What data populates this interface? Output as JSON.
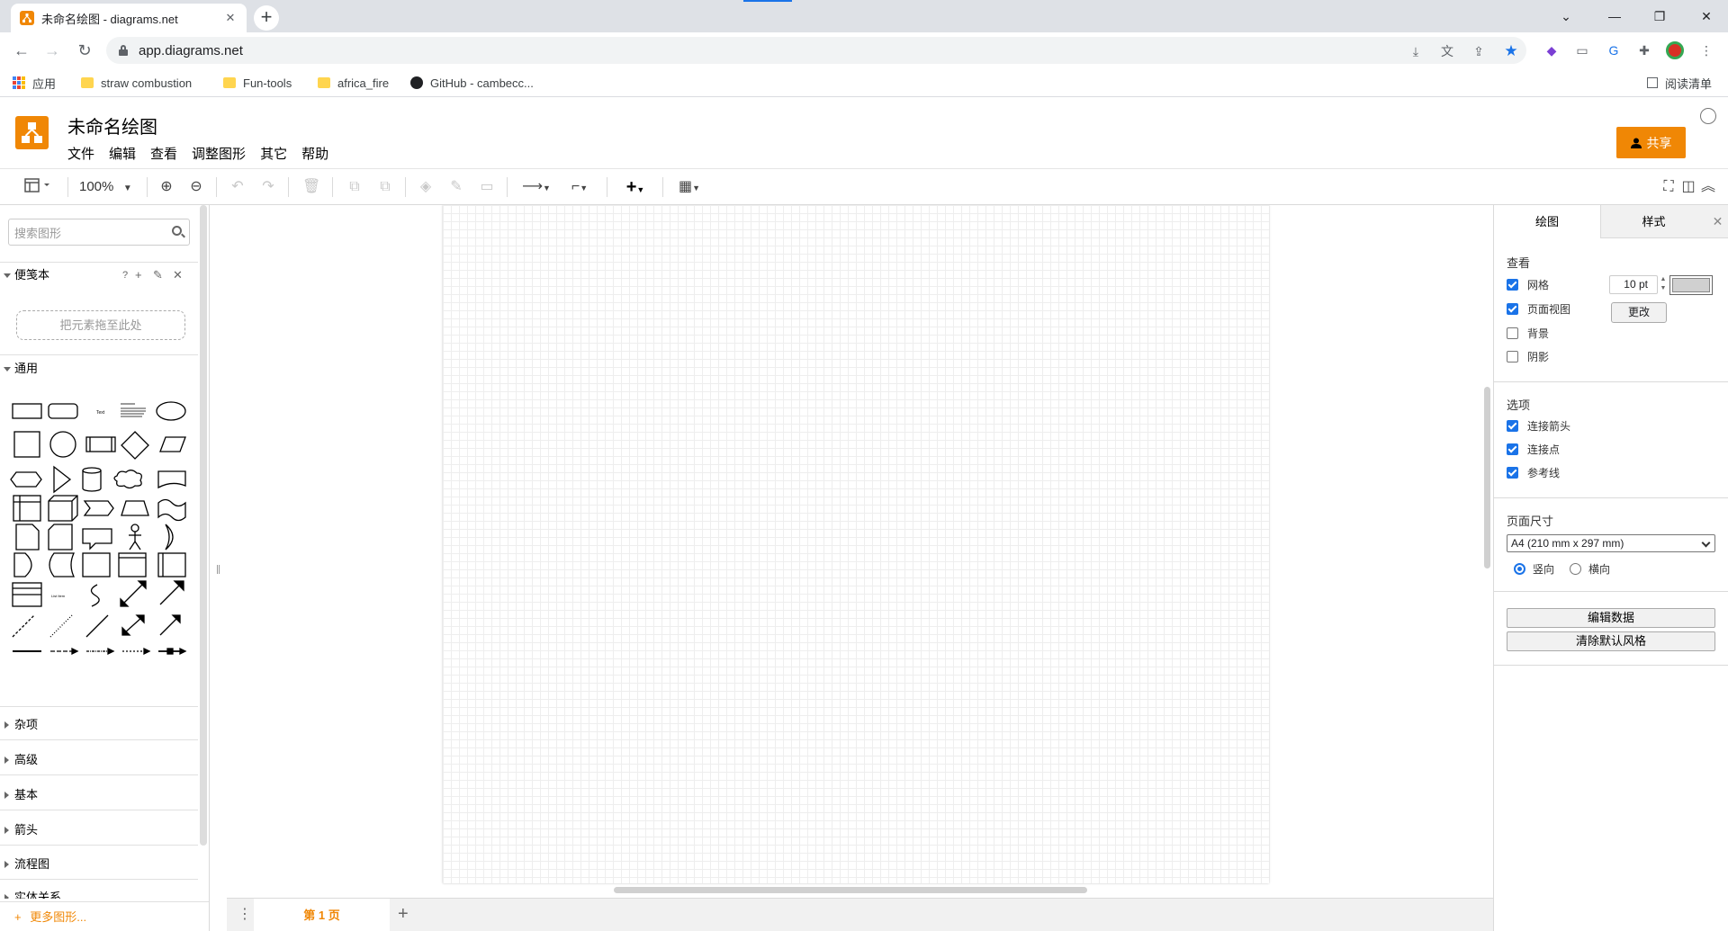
{
  "browser": {
    "tab_title": "未命名绘图 - diagrams.net",
    "url": "app.diagrams.net",
    "bookmarks": [
      {
        "label": "应用",
        "icon": "apps-grid-icon"
      },
      {
        "label": "straw combustion",
        "icon": "folder-icon"
      },
      {
        "label": "Fun-tools",
        "icon": "folder-icon"
      },
      {
        "label": "africa_fire",
        "icon": "folder-icon"
      },
      {
        "label": "GitHub - cambecc...",
        "icon": "github-icon"
      }
    ],
    "reading_list": "阅读清单"
  },
  "app": {
    "title": "未命名绘图",
    "brand_color": "#f08705",
    "menu": [
      "文件",
      "编辑",
      "查看",
      "调整图形",
      "其它",
      "帮助"
    ],
    "share_label": "共享"
  },
  "toolbar": {
    "zoom": "100%"
  },
  "sidebar": {
    "search_placeholder": "搜索图形",
    "scratchpad_title": "便笺本",
    "scratchpad_drop": "把元素拖至此处",
    "general_title": "通用",
    "collapsed_sections": [
      "杂项",
      "高级",
      "基本",
      "箭头",
      "流程图",
      "实体关系"
    ],
    "more_shapes": "更多图形..."
  },
  "pages": {
    "current": "第 1 页"
  },
  "format_panel": {
    "tab_diagram": "绘图",
    "tab_style": "样式",
    "view_head": "查看",
    "grid_label": "网格",
    "grid_checked": true,
    "grid_size": "10 pt",
    "page_view_label": "页面视图",
    "page_view_checked": true,
    "background_label": "背景",
    "background_checked": false,
    "change_label": "更改",
    "shadow_label": "阴影",
    "shadow_checked": false,
    "options_head": "选项",
    "connection_arrows_label": "连接箭头",
    "connection_points_label": "连接点",
    "guides_label": "参考线",
    "page_size_head": "页面尺寸",
    "page_size_value": "A4 (210 mm x 297 mm)",
    "portrait_label": "竖向",
    "landscape_label": "横向",
    "orientation": "portrait",
    "edit_data_label": "编辑数据",
    "clear_style_label": "清除默认风格"
  }
}
